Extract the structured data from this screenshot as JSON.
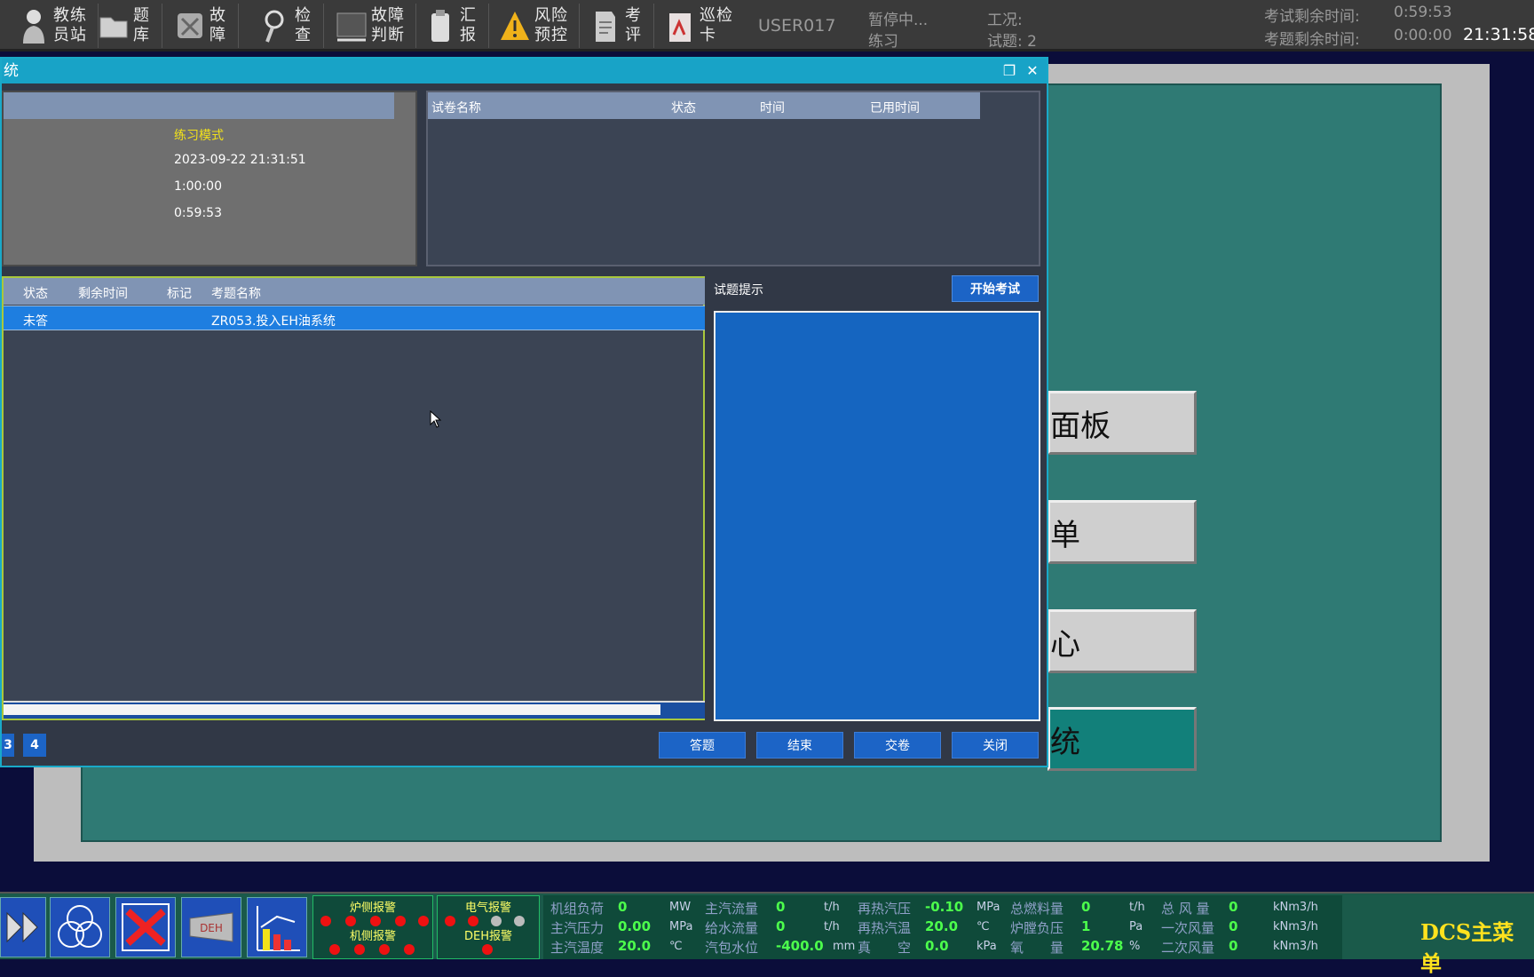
{
  "toolbar": {
    "items": [
      {
        "label": "教练员站",
        "icon": "instructor-icon"
      },
      {
        "label": "题库",
        "icon": "folder-icon"
      },
      {
        "label": "故障",
        "icon": "fault-icon"
      },
      {
        "label": "检查",
        "icon": "inspect-icon"
      },
      {
        "label": "故障判断",
        "icon": "diagnose-icon"
      },
      {
        "label": "汇报",
        "icon": "report-icon"
      },
      {
        "label": "风险预控",
        "icon": "warning-icon"
      },
      {
        "label": "考评",
        "icon": "evaluate-icon"
      },
      {
        "label": "巡检卡",
        "icon": "patrol-card-icon"
      }
    ],
    "user": "USER017",
    "status1": "暂停中...",
    "status2": "练习",
    "condition_label": "工况:",
    "question_label": "试题: 2",
    "exam_remaining_label": "考试剩余时间:",
    "exam_remaining_value": "0:59:53",
    "question_remaining_label": "考题剩余时间:",
    "question_remaining_value": "0:00:00",
    "clock": "21:31:58"
  },
  "window": {
    "title": "统",
    "restore_icon": "restore-icon",
    "close_icon": "close-icon"
  },
  "info": {
    "mode": "练习模式",
    "start_time": "2023-09-22 21:31:51",
    "total_time": "1:00:00",
    "remaining": "0:59:53"
  },
  "paper_table": {
    "headers": [
      "试卷名称",
      "状态",
      "时间",
      "已用时间"
    ]
  },
  "question_table": {
    "headers": [
      "状态",
      "剩余时间",
      "标记",
      "考题名称"
    ],
    "rows": [
      {
        "status": "未答",
        "remaining": "",
        "mark": "",
        "name": "ZR053.投入EH油系统"
      }
    ]
  },
  "hint": {
    "label": "试题提示",
    "start_button": "开始考试"
  },
  "pages": [
    "3",
    "4"
  ],
  "actions": [
    "答题",
    "结束",
    "交卷",
    "关闭"
  ],
  "menu_buttons": [
    "面板",
    "单",
    "心",
    "统"
  ],
  "bottom": {
    "alarm1_top": "炉侧报警",
    "alarm1_bottom": "机侧报警",
    "alarm2_top": "电气报警",
    "alarm2_bottom": "DEH报警",
    "deh_label": "DEH",
    "params": [
      {
        "label": "机组负荷",
        "value": "0",
        "unit": "MW"
      },
      {
        "label": "主汽压力",
        "value": "0.00",
        "unit": "MPa"
      },
      {
        "label": "主汽温度",
        "value": "20.0",
        "unit": "℃"
      },
      {
        "label": "主汽流量",
        "value": "0",
        "unit": "t/h"
      },
      {
        "label": "给水流量",
        "value": "0",
        "unit": "t/h"
      },
      {
        "label": "汽包水位",
        "value": "-400.0",
        "unit": "mm"
      },
      {
        "label": "再热汽压",
        "value": "-0.10",
        "unit": "MPa"
      },
      {
        "label": "再热汽温",
        "value": "20.0",
        "unit": "℃"
      },
      {
        "label": "真　　空",
        "value": "0.0",
        "unit": "kPa"
      },
      {
        "label": "总燃料量",
        "value": "0",
        "unit": "t/h"
      },
      {
        "label": "炉膛负压",
        "value": "1",
        "unit": "Pa"
      },
      {
        "label": "氧　　量",
        "value": "20.78",
        "unit": "%"
      },
      {
        "label": "总 风 量",
        "value": "0",
        "unit": "kNm3/h"
      },
      {
        "label": "一次风量",
        "value": "0",
        "unit": "kNm3/h"
      },
      {
        "label": "二次风量",
        "value": "0",
        "unit": "kNm3/h"
      }
    ],
    "dcs": "DCS主菜单"
  }
}
